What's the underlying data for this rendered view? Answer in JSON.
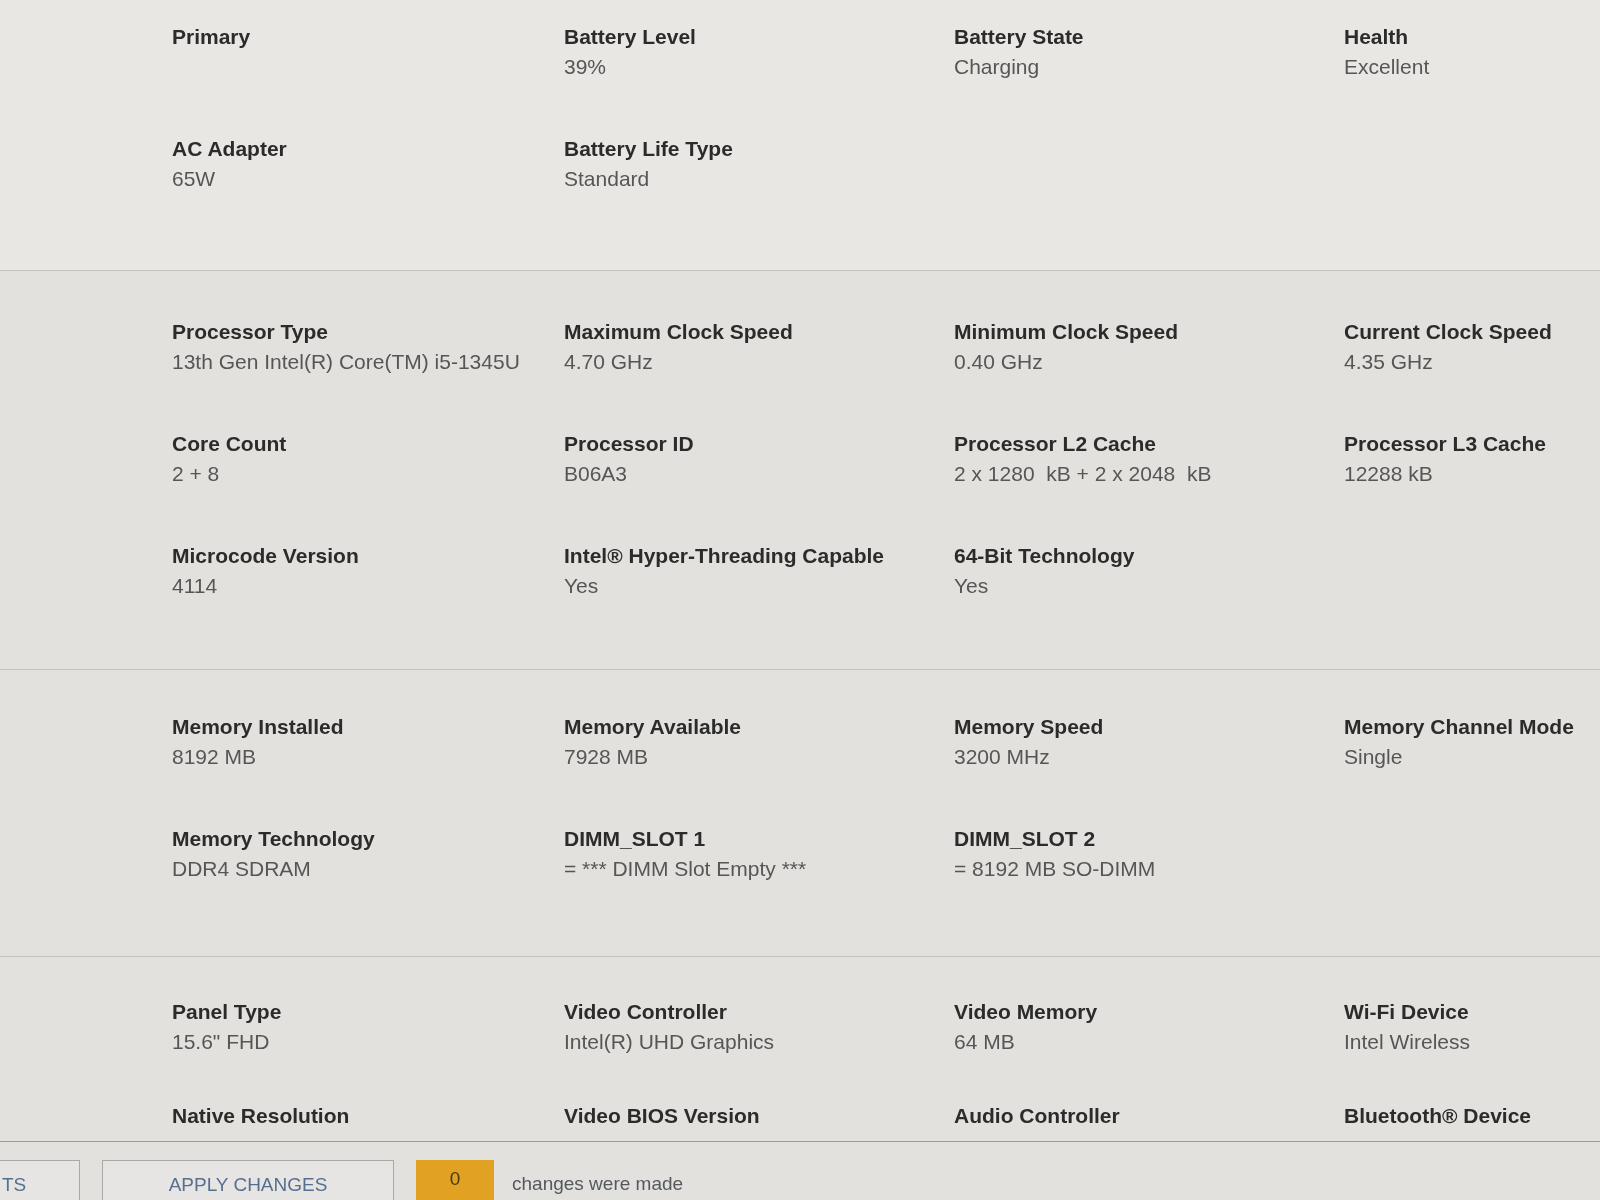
{
  "sections": [
    {
      "items": [
        {
          "label": "Primary"
        },
        {
          "label": "Battery Level",
          "value": "39%"
        },
        {
          "label": "Battery State",
          "value": "Charging"
        },
        {
          "label": "Health",
          "value": "Excellent"
        },
        {
          "label": "AC Adapter",
          "value": "65W"
        },
        {
          "label": "Battery Life Type",
          "value": "Standard"
        }
      ]
    },
    {
      "items": [
        {
          "label": "Processor Type",
          "value": "13th Gen Intel(R) Core(TM) i5-1345U"
        },
        {
          "label": "Maximum Clock Speed",
          "value": "4.70 GHz"
        },
        {
          "label": "Minimum Clock Speed",
          "value": "0.40 GHz"
        },
        {
          "label": "Current Clock Speed",
          "value": "4.35 GHz"
        },
        {
          "label": "Core Count",
          "value": "2 + 8"
        },
        {
          "label": "Processor ID",
          "value": "B06A3"
        },
        {
          "label": "Processor L2 Cache",
          "value": "2 x 1280  kB + 2 x 2048  kB"
        },
        {
          "label": "Processor L3 Cache",
          "value": "12288 kB"
        },
        {
          "label": "Microcode Version",
          "value": "4114"
        },
        {
          "label": "Intel® Hyper-Threading Capable",
          "value": "Yes"
        },
        {
          "label": "64-Bit Technology",
          "value": "Yes"
        }
      ]
    },
    {
      "items": [
        {
          "label": "Memory Installed",
          "value": "8192 MB"
        },
        {
          "label": "Memory Available",
          "value": "7928 MB"
        },
        {
          "label": "Memory Speed",
          "value": "3200 MHz"
        },
        {
          "label": "Memory Channel Mode",
          "value": "Single"
        },
        {
          "label": "Memory Technology",
          "value": "DDR4 SDRAM"
        },
        {
          "label": "DIMM_SLOT 1",
          "value": "= *** DIMM Slot Empty ***"
        },
        {
          "label": "DIMM_SLOT 2",
          "value": "= 8192 MB SO-DIMM"
        }
      ]
    },
    {
      "items": [
        {
          "label": "Panel Type",
          "value": "15.6\" FHD"
        },
        {
          "label": "Video Controller",
          "value": "Intel(R) UHD Graphics"
        },
        {
          "label": "Video Memory",
          "value": "64 MB"
        },
        {
          "label": "Wi-Fi Device",
          "value": "Intel Wireless"
        },
        {
          "label": "Native Resolution"
        },
        {
          "label": "Video BIOS Version"
        },
        {
          "label": "Audio Controller"
        },
        {
          "label": "Bluetooth® Device"
        }
      ]
    }
  ],
  "footer": {
    "buttons": [
      {
        "label": "TS"
      },
      {
        "label": "APPLY CHANGES"
      }
    ],
    "change_count": "0",
    "status": "changes were made"
  }
}
